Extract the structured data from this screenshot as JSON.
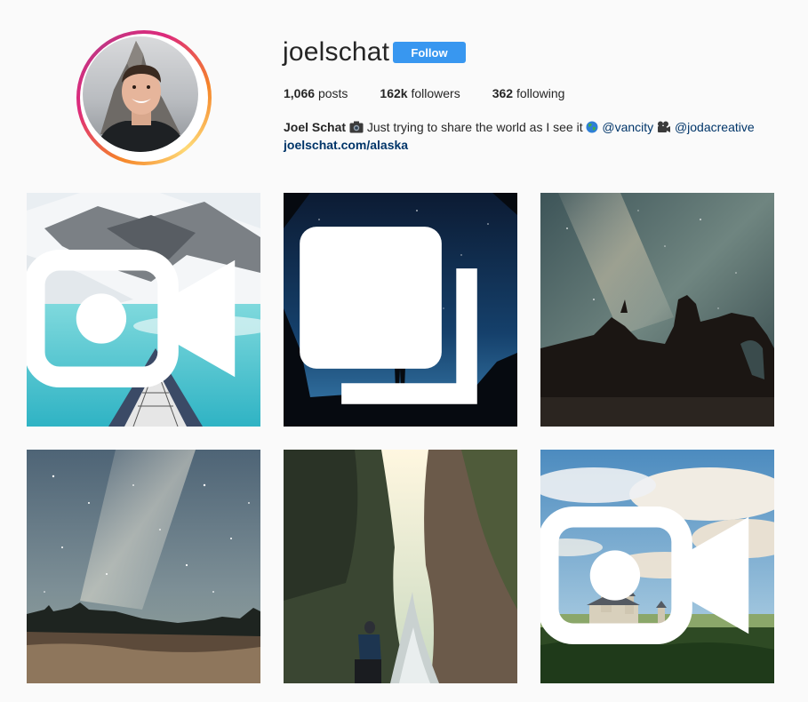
{
  "profile": {
    "username": "joelschat",
    "follow_label": "Follow",
    "stats": {
      "posts_count": "1,066",
      "posts_label": "posts",
      "followers_count": "162k",
      "followers_label": "followers",
      "following_count": "362",
      "following_label": "following"
    },
    "bio": {
      "name": "Joel Schat",
      "text": "Just trying to share the world as I see it",
      "mention1": "@vancity",
      "mention2": "@jodacreative",
      "link": "joelschat.com/alaska"
    },
    "icons": {
      "camera": "camera-emoji-icon",
      "globe": "globe-emoji-icon",
      "film": "movie-camera-emoji-icon"
    }
  },
  "posts": [
    {
      "badge": "video",
      "scene": "kayak on turquoise glacial lake with snowy mountains"
    },
    {
      "badge": "carousel",
      "scene": "silhouette of person standing under starry blue sky"
    },
    {
      "badge": "none",
      "scene": "milky way over rock arch silhouettes"
    },
    {
      "badge": "none",
      "scene": "starry night sky over treeline and cliffs"
    },
    {
      "badge": "none",
      "scene": "hiker in narrow mossy gorge with river"
    },
    {
      "badge": "video",
      "scene": "castle on hill under clouds at sunset"
    }
  ],
  "colors": {
    "follow_button": "#3897f0",
    "mention_link": "#003569",
    "background": "#fafafa"
  }
}
